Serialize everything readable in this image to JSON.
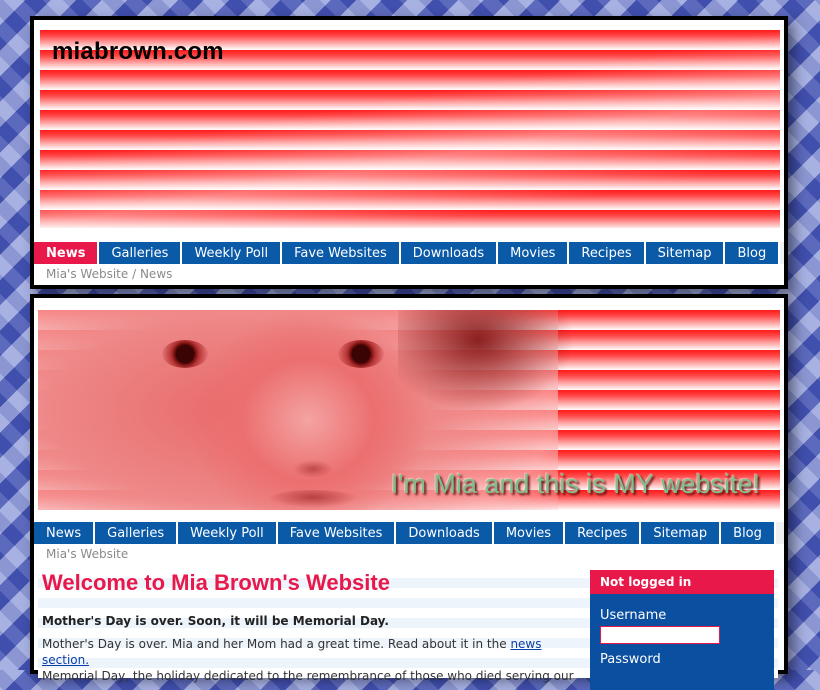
{
  "site_title": "miabrown.com",
  "header_nav": [
    {
      "label": "News",
      "active": true
    },
    {
      "label": "Galleries"
    },
    {
      "label": "Weekly Poll"
    },
    {
      "label": "Fave Websites"
    },
    {
      "label": "Downloads"
    },
    {
      "label": "Movies"
    },
    {
      "label": "Recipes"
    },
    {
      "label": "Sitemap"
    },
    {
      "label": "Blog"
    }
  ],
  "breadcrumb1": {
    "home": "Mia's Website",
    "separator": "/",
    "current": "News"
  },
  "banner_tagline": "I'm Mia and this is MY website!",
  "main_nav": [
    {
      "label": "News"
    },
    {
      "label": "Galleries"
    },
    {
      "label": "Weekly Poll"
    },
    {
      "label": "Fave Websites"
    },
    {
      "label": "Downloads"
    },
    {
      "label": "Movies"
    },
    {
      "label": "Recipes"
    },
    {
      "label": "Sitemap"
    },
    {
      "label": "Blog"
    }
  ],
  "breadcrumb2": {
    "home": "Mia's Website"
  },
  "welcome": {
    "heading": "Welcome to Mia Brown's Website",
    "intro": "Mother's Day is over. Soon, it will be Memorial Day.",
    "para_start": "Mother's Day is over. Mia and her Mom had a great time. Read about it in the ",
    "para_link": "news section.",
    "para_line2": "Memorial Day, the holiday dedicated to the remembrance of those who died serving our"
  },
  "login": {
    "status": "Not logged in",
    "username_label": "Username",
    "password_label": "Password"
  },
  "colors": {
    "accent": "#e8184a",
    "nav_blue": "#0a5aa8",
    "login_blue": "#0a4fa0"
  }
}
